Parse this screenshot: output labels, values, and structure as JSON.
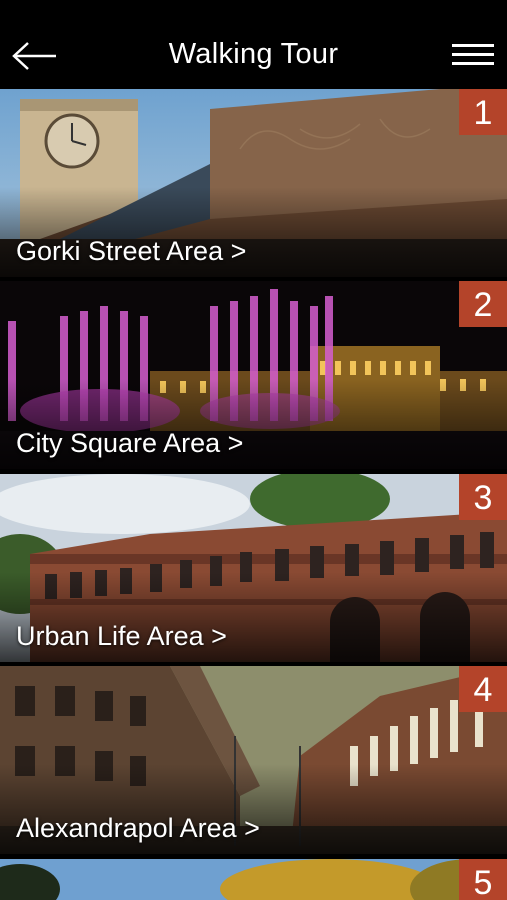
{
  "header": {
    "title": "Walking Tour",
    "back_icon": "arrow-left-icon",
    "menu_icon": "hamburger-menu-icon"
  },
  "tiles": [
    {
      "number": "1",
      "label": "Gorki Street Area >"
    },
    {
      "number": "2",
      "label": "City Square Area >"
    },
    {
      "number": "3",
      "label": "Urban Life Area >"
    },
    {
      "number": "4",
      "label": "Alexandrapol Area >"
    },
    {
      "number": "5",
      "label": ""
    }
  ],
  "colors": {
    "badge": "#b4442a",
    "header_bg": "#000000",
    "text": "#ffffff"
  }
}
